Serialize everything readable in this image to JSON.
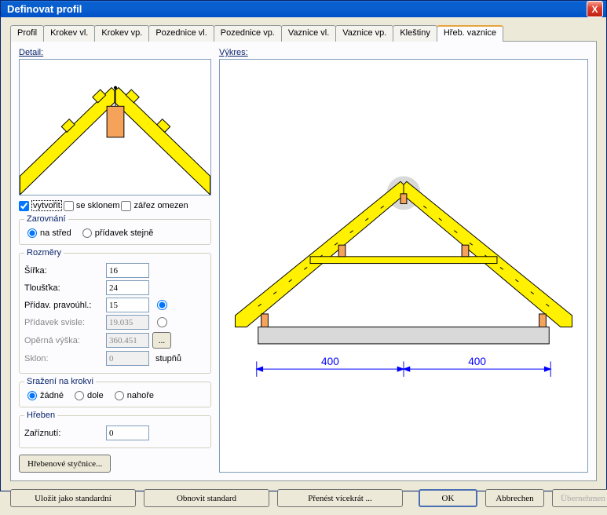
{
  "window": {
    "title": "Definovat profil",
    "close": "X"
  },
  "tabs": [
    "Profil",
    "Krokev vl.",
    "Krokev vp.",
    "Pozednice vl.",
    "Pozednice vp.",
    "Vaznice vl.",
    "Vaznice vp.",
    "Kleštiny",
    "Hřeb. vaznice"
  ],
  "active_tab": 8,
  "left": {
    "detail_label": "Detail:",
    "checks": {
      "create": "vytvořit",
      "withslope": "se sklonem",
      "notchlimit": "zářez omezen"
    },
    "alignment": {
      "legend": "Zarovnání",
      "center": "na střed",
      "even": "přídavek stejně"
    },
    "dims": {
      "legend": "Rozměry",
      "width_l": "Šířka:",
      "width_v": "16",
      "thick_l": "Tloušťka:",
      "thick_v": "24",
      "add_perp_l": "Přídav. pravoúhl.:",
      "add_perp_v": "15",
      "add_vert_l": "Přídavek svisle:",
      "add_vert_v": "19.035",
      "sup_h_l": "Opěrná výška:",
      "sup_h_v": "360.451",
      "more_btn": "...",
      "slope_l": "Sklon:",
      "slope_v": "0",
      "slope_unit": "stupňů"
    },
    "chamfer": {
      "legend": "Sražení na krokvi",
      "none": "žádné",
      "bottom": "dole",
      "top": "nahoře"
    },
    "ridge": {
      "legend": "Hřeben",
      "cut_l": "Zaříznutí:",
      "cut_v": "0"
    },
    "joints_btn": "Hřebenové styčnice..."
  },
  "right": {
    "drawing_label": "Výkres:",
    "dim_left": "400",
    "dim_right": "400"
  },
  "buttons": {
    "save_std": "Uložit jako standardní",
    "restore_std": "Obnovit standard",
    "transfer": "Přenést vícekrát ...",
    "ok": "OK",
    "cancel": "Abbrechen",
    "apply": "Übernehmen"
  }
}
